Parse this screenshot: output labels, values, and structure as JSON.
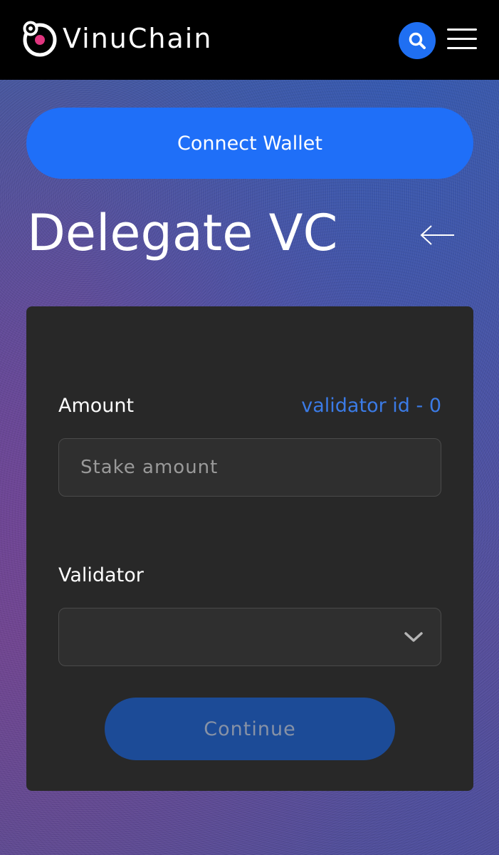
{
  "header": {
    "brand": "VinuChain",
    "logo_icon": "vinuchain-logo-icon",
    "search_icon": "search-icon",
    "menu_icon": "hamburger-menu-icon"
  },
  "wallet": {
    "connect_label": "Connect Wallet"
  },
  "page": {
    "title": "Delegate VC",
    "back_icon": "arrow-left-icon"
  },
  "form": {
    "amount_label": "Amount",
    "validator_id_link": "validator id - 0",
    "amount_placeholder": "Stake amount",
    "amount_value": "",
    "validator_label": "Validator",
    "validator_selected": "",
    "continue_label": "Continue"
  },
  "colors": {
    "accent": "#1f6ff8",
    "link": "#3b7be6",
    "card_bg": "#282828",
    "continue_disabled_bg": "#1c4b97",
    "logo_dot": "#e0357f"
  }
}
